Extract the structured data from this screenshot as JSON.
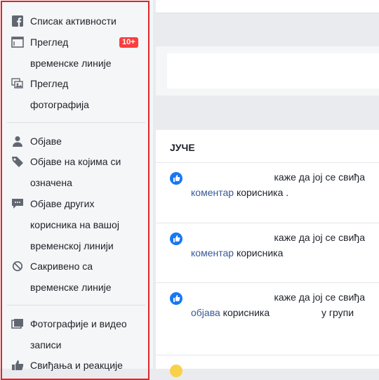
{
  "sidebar": {
    "items": [
      {
        "label": "Списак активности",
        "icon": "facebook-icon"
      },
      {
        "label": "Преглед временске линије",
        "line1": "Преглед",
        "line2": "временске линије",
        "badge": "10+",
        "icon": "timeline-icon"
      },
      {
        "label": "Преглед фотографија",
        "line1": "Преглед",
        "line2": "фотографија",
        "icon": "photo-review-icon"
      },
      {
        "label": "Објаве",
        "icon": "person-icon"
      },
      {
        "label": "Објаве на којима си означена",
        "line1": "Објаве на којима си",
        "line2": "означена",
        "icon": "tag-icon"
      },
      {
        "label": "Објаве других корисника на вашој временској линији",
        "line1": "Објаве других",
        "line2": "корисника на вашој",
        "line3": "временској линији",
        "icon": "comment-icon"
      },
      {
        "label": "Сакривено са временске линије",
        "line1": "Сакривено са",
        "line2": "временске линије",
        "icon": "hidden-icon"
      },
      {
        "label": "Фотографије и видео записи",
        "line1": "Фотографије и видео",
        "line2": "записи",
        "icon": "photos-icon"
      },
      {
        "label": "Свиђања и реакције",
        "icon": "like-icon"
      }
    ]
  },
  "activity": {
    "day_header": "ЈУЧЕ",
    "items": [
      {
        "line1": "каже да јој се свиђа",
        "link": "коментар",
        "rest": "корисника",
        "trail": "."
      },
      {
        "line1": "каже да јој се свиђа",
        "link": "коментар",
        "rest": "корисника",
        "trail": ""
      },
      {
        "line1": "каже да јој се свиђа",
        "link": "објава",
        "rest": "корисника",
        "trail": "у групи"
      }
    ]
  },
  "colors": {
    "sidebar_border": "#e0242c",
    "badge": "#fa3e3e",
    "link": "#385898",
    "like_blue": "#1877f2",
    "icon_gray": "#606770"
  }
}
